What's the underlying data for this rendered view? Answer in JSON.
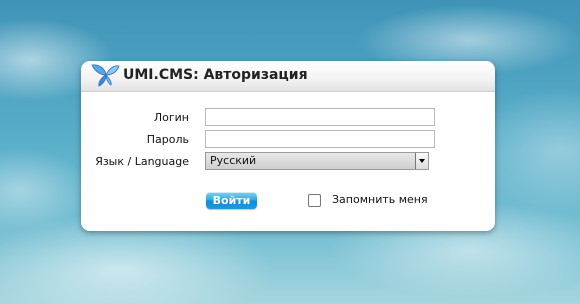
{
  "header": {
    "title": "UMI.CMS: Авторизация",
    "logo_icon": "butterfly-logo-icon"
  },
  "form": {
    "login_label": "Логин",
    "login_value": "",
    "password_label": "Пароль",
    "password_value": "",
    "language_label": "Язык / Language",
    "language_selected": "Русский",
    "submit_label": "Войти",
    "remember_label": "Запомнить меня",
    "remember_checked": false
  },
  "colors": {
    "button_accent": "#1b9ad9",
    "background_sky": "#4a9fbd"
  }
}
